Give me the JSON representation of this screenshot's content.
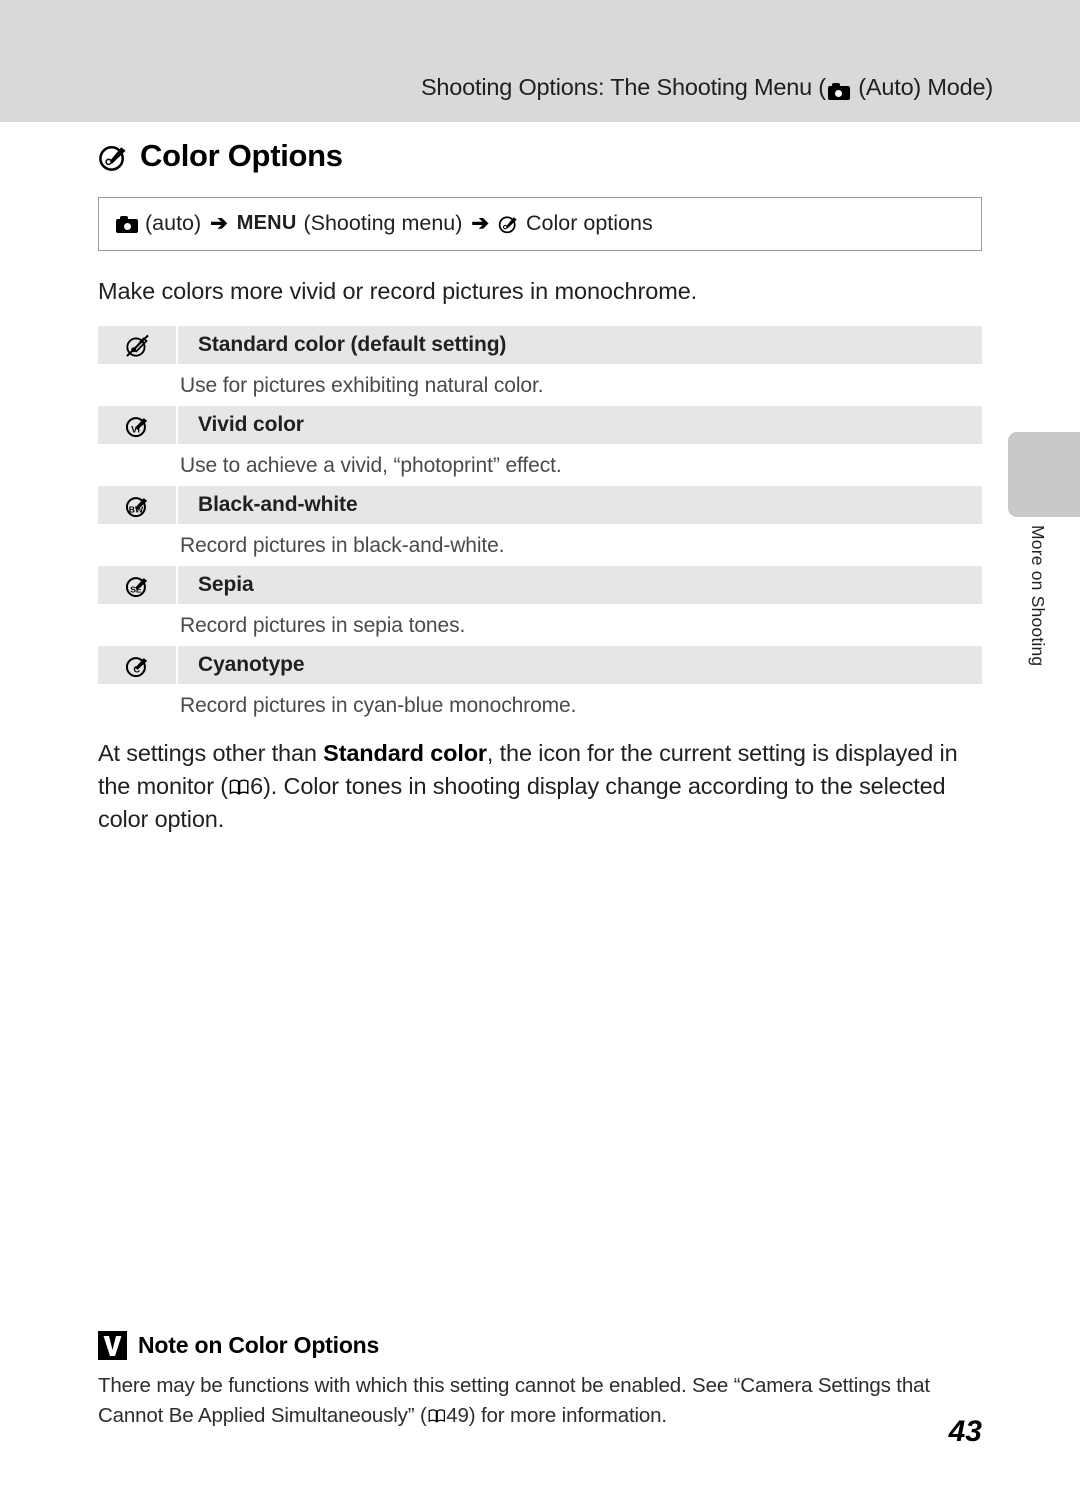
{
  "header": {
    "title_before_icon": "Shooting Options: The Shooting Menu (",
    "icon": "camera-auto-icon",
    "title_after_icon": " (Auto) Mode)"
  },
  "page_title": {
    "icon": "color-options-brush-icon",
    "text": "Color Options"
  },
  "breadcrumb": {
    "camera_icon": "camera-auto-icon",
    "step1": "(auto)",
    "arrow": "➔",
    "menu_label": "MENU",
    "step2": "(Shooting menu)",
    "arrow2": "➔",
    "brush_icon": "color-options-brush-icon",
    "step3": "Color options"
  },
  "intro": "Make colors more vivid or record pictures in monochrome.",
  "options": [
    {
      "icon": "brush-crossed-out-icon",
      "icon_label": "",
      "crossed": true,
      "name": "Standard color (default setting)",
      "description": "Use for pictures exhibiting natural color."
    },
    {
      "icon": "brush-vivid-icon",
      "icon_label": "VI",
      "crossed": false,
      "name": "Vivid color",
      "description": "Use to achieve a vivid, “photoprint” effect."
    },
    {
      "icon": "brush-black-and-white-icon",
      "icon_label": "BW",
      "crossed": false,
      "name": "Black-and-white",
      "description": "Record pictures in black-and-white."
    },
    {
      "icon": "brush-sepia-icon",
      "icon_label": "SE",
      "crossed": false,
      "name": "Sepia",
      "description": "Record pictures in sepia tones."
    },
    {
      "icon": "brush-cyanotype-icon",
      "icon_label": "C",
      "crossed": false,
      "name": "Cyanotype",
      "description": "Record pictures in cyan-blue monochrome."
    }
  ],
  "body_paragraph": {
    "part1": "At settings other than ",
    "bold": "Standard color",
    "part2": ", the icon for the current setting is displayed in the monitor (",
    "book_icon": "open-book-icon",
    "page_ref": "6",
    "part3": "). Color tones in shooting display change according to the selected color option."
  },
  "side_tab": {
    "label": "More on Shooting"
  },
  "note": {
    "badge_icon": "check-mark-badge-icon",
    "title": "Note on Color Options",
    "body_part1": "There may be functions with which this setting cannot be enabled. See “Camera Settings that Cannot Be Applied Simultaneously” (",
    "book_icon": "open-book-icon",
    "page_ref": "49",
    "body_part2": ") for more information."
  },
  "page_number": "43",
  "colors": {
    "header_band": "#d9d9d9",
    "table_row": "#e6e6e6",
    "side_tab": "#c9c9c9",
    "text": "#231f20",
    "box_border": "#9b9b9b"
  }
}
